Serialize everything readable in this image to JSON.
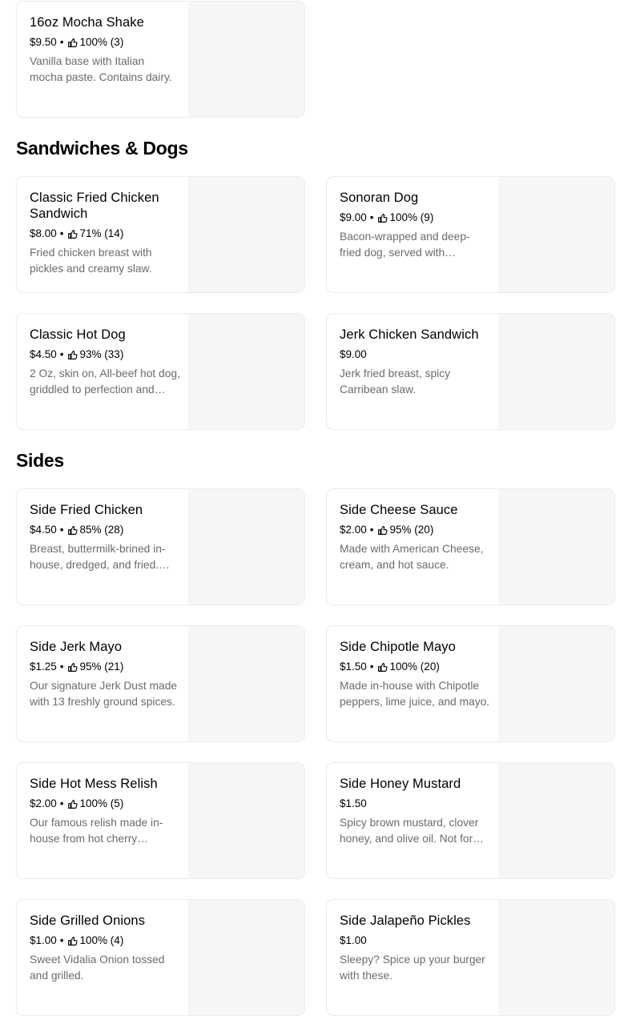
{
  "sections": {
    "sandwiches": "Sandwiches & Dogs",
    "sides": "Sides"
  },
  "items": {
    "mocha_shake": {
      "name": "16oz Mocha Shake",
      "price": "$9.50",
      "rating": "100% (3)",
      "desc": "Vanilla base with Italian mocha paste. Contains dairy."
    },
    "classic_fried_chicken": {
      "name": "Classic Fried Chicken Sandwich",
      "price": "$8.00",
      "rating": "71% (14)",
      "desc": "Fried chicken breast with pickles and creamy slaw."
    },
    "sonoran_dog": {
      "name": "Sonoran Dog",
      "price": "$9.00",
      "rating": "100% (9)",
      "desc": "Bacon-wrapped and deep-fried dog, served with toppings."
    },
    "classic_hot_dog": {
      "name": "Classic Hot Dog",
      "price": "$4.50",
      "rating": "93% (33)",
      "desc": "2 Oz, skin on, All-beef hot dog, griddled to perfection and served."
    },
    "jerk_chicken": {
      "name": "Jerk Chicken Sandwich",
      "price": "$9.00",
      "rating": "",
      "desc": "Jerk fried breast, spicy Carribean slaw."
    },
    "side_fried_chicken": {
      "name": "Side Fried Chicken",
      "price": "$4.50",
      "rating": "85% (28)",
      "desc": "Breast, buttermilk-brined in-house, dredged, and fried. Served."
    },
    "side_cheese_sauce": {
      "name": "Side Cheese Sauce",
      "price": "$2.00",
      "rating": "95% (20)",
      "desc": "Made with American Cheese, cream, and hot sauce."
    },
    "side_jerk_mayo": {
      "name": "Side Jerk Mayo",
      "price": "$1.25",
      "rating": "95% (21)",
      "desc": "Our signature Jerk Dust made with 13 freshly ground spices."
    },
    "side_chipotle_mayo": {
      "name": "Side Chipotle Mayo",
      "price": "$1.50",
      "rating": "100% (20)",
      "desc": "Made in-house with Chipotle peppers, lime juice, and mayo."
    },
    "side_hot_mess_relish": {
      "name": "Side Hot Mess Relish",
      "price": "$2.00",
      "rating": "100% (5)",
      "desc": "Our famous relish made in-house from hot cherry peppers."
    },
    "side_honey_mustard": {
      "name": "Side Honey Mustard",
      "price": "$1.50",
      "rating": "",
      "desc": "Spicy brown mustard, clover honey, and olive oil. Not for the faint."
    },
    "side_grilled_onions": {
      "name": "Side Grilled Onions",
      "price": "$1.00",
      "rating": "100% (4)",
      "desc": "Sweet Vidalia Onion tossed and grilled."
    },
    "side_jalapeno_pickles": {
      "name": "Side Jalapeño Pickles",
      "price": "$1.00",
      "rating": "",
      "desc": "Sleepy? Spice up your burger with these."
    }
  },
  "icons": {
    "rating": "thumbs-up-icon"
  },
  "colors": {
    "card_border": "#ececec",
    "image_placeholder": "#f6f6f6",
    "desc_text": "#6b6b6b"
  }
}
